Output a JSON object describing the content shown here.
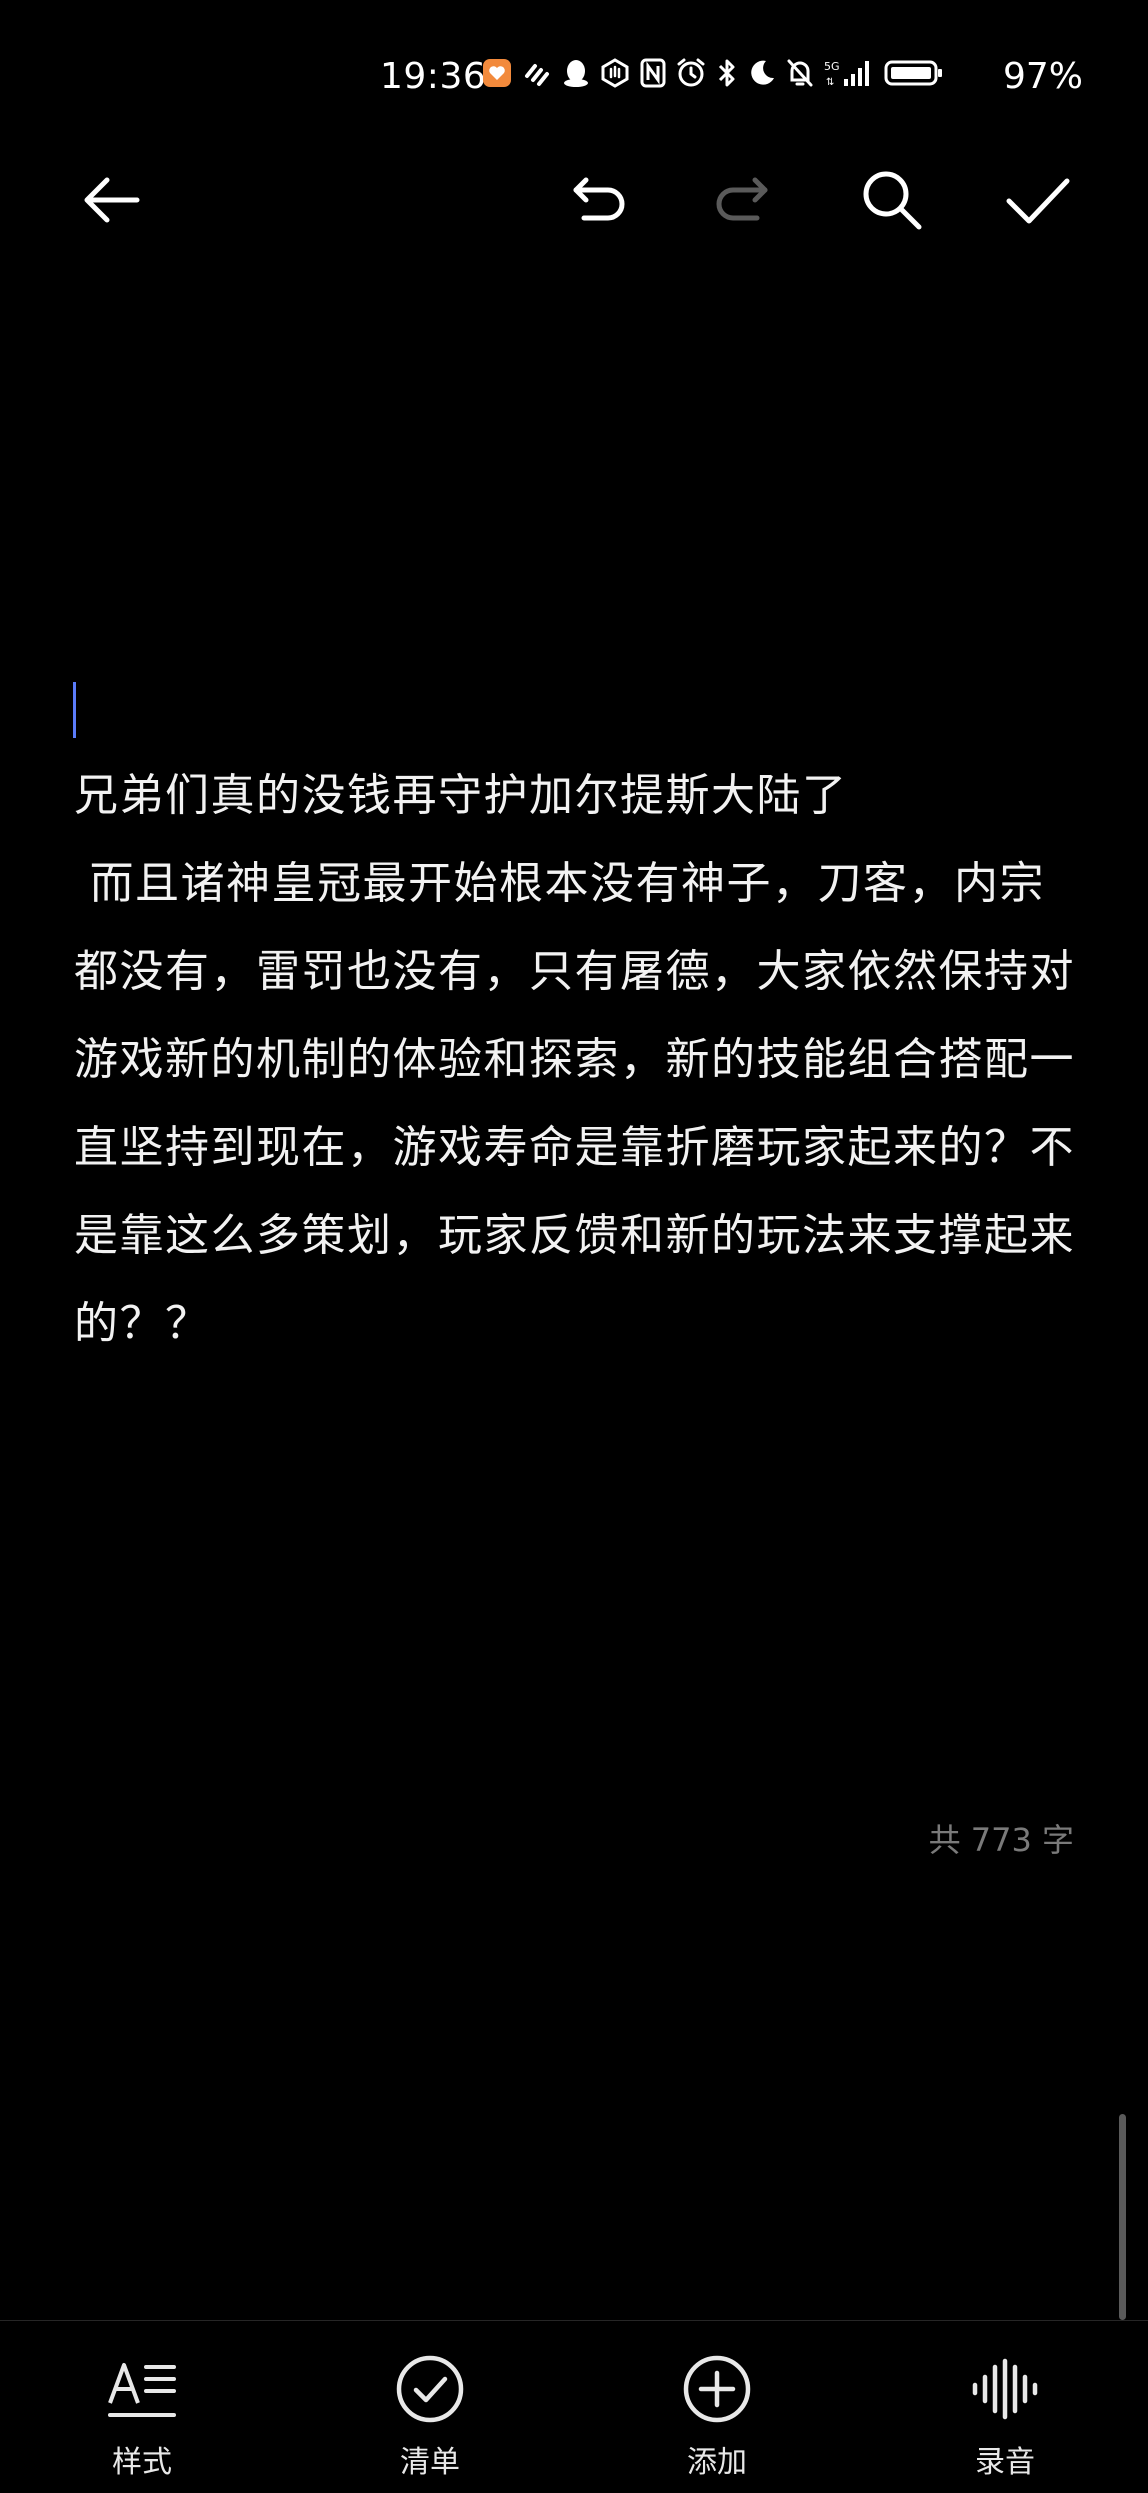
{
  "status_bar": {
    "time": "19:36",
    "battery_percent": "97%",
    "icons": [
      "app-notification-icon",
      "link-icon",
      "qq-icon",
      "hand-icon",
      "nfc-icon",
      "alarm-icon",
      "bluetooth-icon",
      "moon-icon",
      "mute-icon",
      "signal-5g-icon",
      "battery-icon"
    ]
  },
  "toolbar": {
    "back_icon": "back-arrow-icon",
    "undo_icon": "undo-icon",
    "redo_icon": "redo-icon",
    "search_icon": "search-icon",
    "done_icon": "checkmark-icon"
  },
  "note": {
    "body": "兄弟们真的没钱再守护加尔提斯大陆了\n 而且诸神皇冠最开始根本没有神子，刀客，内宗都没有，雷罚也没有，只有屠德，大家依然保持对游戏新的机制的体验和探索，新的技能组合搭配一直坚持到现在，游戏寿命是靠折磨玩家起来的？不是靠这么多策划，玩家反馈和新的玩法来支撑起来的？？",
    "word_count": "共 773 字"
  },
  "colors": {
    "background": "#000000",
    "text": "#f2f2f2",
    "cursor": "#5b7cfa",
    "muted": "#7a7a7a"
  },
  "bottom_bar": {
    "items": [
      {
        "label": "样式",
        "icon": "text-style-icon"
      },
      {
        "label": "清单",
        "icon": "checklist-icon"
      },
      {
        "label": "添加",
        "icon": "add-circle-icon"
      },
      {
        "label": "录音",
        "icon": "audio-waveform-icon"
      }
    ]
  }
}
